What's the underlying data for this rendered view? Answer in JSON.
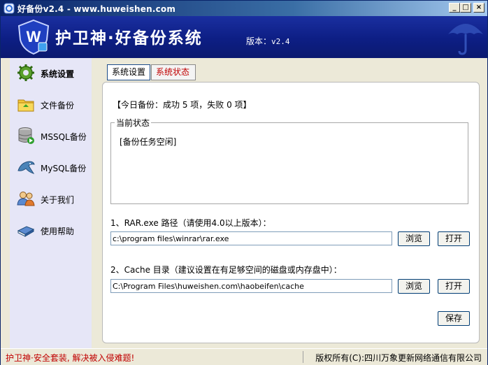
{
  "window": {
    "title": "好备份v2.4 - www.huweishen.com",
    "controls": {
      "minimize": "_",
      "maximize": "□",
      "close": "×"
    }
  },
  "banner": {
    "title": "护卫神·好备份系统",
    "version_label": "版本：",
    "version_value": "v2.4",
    "logo_icon": "shield-w-icon",
    "decor_icon": "umbrella-icon"
  },
  "sidebar": {
    "items": [
      {
        "label": "系统设置",
        "icon": "gear-icon",
        "active": true
      },
      {
        "label": "文件备份",
        "icon": "folder-icon",
        "active": false
      },
      {
        "label": "MSSQL备份",
        "icon": "database-icon",
        "active": false
      },
      {
        "label": "MySQL备份",
        "icon": "dolphin-icon",
        "active": false
      },
      {
        "label": "关于我们",
        "icon": "people-icon",
        "active": false
      },
      {
        "label": "使用帮助",
        "icon": "book-icon",
        "active": false
      }
    ]
  },
  "tabs": [
    {
      "label": "系统设置"
    },
    {
      "label": "系统状态"
    }
  ],
  "main": {
    "summary": "【今日备份：成功 5 项，失败 0 项】",
    "status_group": {
      "legend": "当前状态",
      "text": "[备份任务空闲]"
    },
    "rar": {
      "label": "1、RAR.exe 路径（请使用4.0以上版本）：",
      "value": "c:\\program files\\winrar\\rar.exe",
      "browse": "浏览",
      "open": "打开"
    },
    "cache": {
      "label": "2、Cache 目录（建议设置在有足够空间的磁盘或内存盘中）：",
      "value": "C:\\Program Files\\huweishen.com\\haobeifen\\cache",
      "browse": "浏览",
      "open": "打开"
    },
    "save": "保存"
  },
  "statusbar": {
    "left": "护卫神·安全套装, 解决被入侵难题!",
    "right": "版权所有(C):四川万象更新网络通信有限公司"
  },
  "colors": {
    "banner": "#0d1e84",
    "sidebar": "#e6e6f7",
    "accent_red": "#c00000",
    "title_bar": "#0a246a"
  }
}
